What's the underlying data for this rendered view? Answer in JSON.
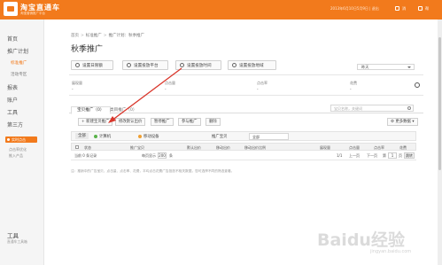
{
  "colors": {
    "brand": "#f27a1c",
    "arrow": "#d9362b",
    "status_green": "#59b34a",
    "status_orange": "#f0a033"
  },
  "header": {
    "logo_title": "淘宝直通车",
    "logo_sub": "淘宝营销推广平台",
    "user_info": "2013年6月10日5月9日 | 退出",
    "msg_label": "消",
    "help_label": "帮"
  },
  "sidebar": {
    "items": [
      {
        "label": "首页"
      },
      {
        "label": "推广计划"
      }
    ],
    "subitems": [
      {
        "label": "标准推广",
        "active": true
      },
      {
        "label": "活动专区",
        "active": false
      }
    ],
    "more_items": [
      {
        "label": "报表"
      },
      {
        "label": "账户"
      },
      {
        "label": "工具"
      },
      {
        "label": "第三方"
      }
    ],
    "badge_label": "实时点击",
    "small_links": [
      "点击率优化",
      "推入产品"
    ],
    "tool_label": "工具",
    "tool_sub": "直通车工具箱"
  },
  "breadcrumb": {
    "items": [
      "首页",
      "标准推广",
      "推广计划：秋季推广"
    ],
    "separator": ">"
  },
  "page_title": "秋季推广",
  "settings_buttons": [
    {
      "label": "设置日限额",
      "icon": "clock-icon"
    },
    {
      "label": "设置投放平台",
      "icon": "screen-icon"
    },
    {
      "label": "设置投放时间",
      "icon": "timer-icon"
    },
    {
      "label": "设置投放地域",
      "icon": "map-icon"
    }
  ],
  "date_range": "昨天",
  "stats": [
    {
      "label": "展现量",
      "value": "-"
    },
    {
      "label": "点击量",
      "value": "-"
    },
    {
      "label": "点击率",
      "value": "-"
    },
    {
      "label": "花费",
      "value": "-"
    }
  ],
  "tabs": [
    {
      "label": "宝贝推广（0）"
    },
    {
      "label": "类目推广（0）"
    }
  ],
  "search_placeholder": "宝贝名称，关键词",
  "toolbar_buttons": [
    "新建宝贝推广",
    "修改默认出价",
    "暂停推广",
    "参与推广",
    "删除"
  ],
  "more_data_label": "更多数据",
  "filters": {
    "all": "全部",
    "items": [
      "计算机",
      "移动设备",
      "推广宝贝"
    ],
    "select_value": "全部"
  },
  "table": {
    "columns": [
      "状态",
      "推广宝贝",
      "默认出价",
      "移动出价",
      "移动出价比例",
      "展现量",
      "点击量",
      "点击率",
      "花费"
    ],
    "empty_row": {
      "prefix": "当前 0 条记录",
      "perpage_label": "每页显示",
      "perpage_value": "200",
      "perpage_suffix": "条",
      "page_info": "1/1",
      "prev": "上一页",
      "next": "下一页",
      "page_label": "第",
      "page_value": "1",
      "page_unit": "页",
      "jump": "跳转"
    }
  },
  "note": "注：推销中的广告宝贝，点击量、点击率、花费，平均点击花费广告投放不相关数据，您可选择不同的筛选查看。",
  "watermark": {
    "main": "Baidu经验",
    "sub": "jingyan.baidu.com"
  }
}
